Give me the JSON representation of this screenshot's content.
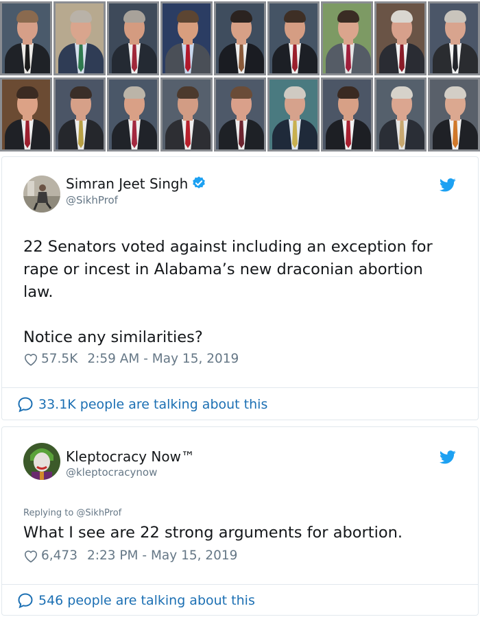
{
  "portrait_grid": {
    "rows": [
      [
        {
          "bg": "#4a5a6b",
          "suit": "#1f2227",
          "shirt": "#eceae6",
          "tie": "#1b1b1b",
          "skin": "#d69f88",
          "hair": "#8a6a4f"
        },
        {
          "bg": "#b7a98f",
          "suit": "#2f3c55",
          "shirt": "#d6e0ec",
          "tie": "#2f7a4f",
          "skin": "#d9a58d",
          "hair": "#b9b2a8"
        },
        {
          "bg": "#3e4a5a",
          "suit": "#242a33",
          "shirt": "#efefef",
          "tie": "#a0283a",
          "skin": "#d49b80",
          "hair": "#a8a29a"
        },
        {
          "bg": "#2b3d63",
          "suit": "#4a4f57",
          "shirt": "#c9d8ee",
          "tie": "#b2182b",
          "skin": "#d89e7e",
          "hair": "#5c4532"
        },
        {
          "bg": "#3f4d5e",
          "suit": "#1a1c22",
          "shirt": "#eeeeee",
          "tie": "#8a5a3a",
          "skin": "#d7a086",
          "hair": "#2b2320"
        },
        {
          "bg": "#455465",
          "suit": "#1c1f25",
          "shirt": "#f0f0f0",
          "tie": "#9a1f2c",
          "skin": "#d59d83",
          "hair": "#3e2f25"
        },
        {
          "bg": "#7d9a64",
          "suit": "#555c66",
          "shirt": "#e6e6e6",
          "tie": "#a01f3c",
          "skin": "#dba58d",
          "hair": "#3a2c24"
        },
        {
          "bg": "#6a5446",
          "suit": "#2a2c33",
          "shirt": "#f2f2f2",
          "tie": "#8a1c28",
          "skin": "#d7a08b",
          "hair": "#d9d6d0"
        },
        {
          "bg": "#4b5668",
          "suit": "#2a2c30",
          "shirt": "#f2f2f2",
          "tie": "#22242a",
          "skin": "#d8a48e",
          "hair": "#c9c4bc"
        }
      ],
      [
        {
          "bg": "#6b4b33",
          "suit": "#1f2126",
          "shirt": "#ededed",
          "tie": "#9c1f2e",
          "skin": "#dca286",
          "hair": "#3b2b22"
        },
        {
          "bg": "#4b5566",
          "suit": "#25272c",
          "shirt": "#ececec",
          "tie": "#b8a045",
          "skin": "#d6a088",
          "hair": "#3a2e28"
        },
        {
          "bg": "#4a5768",
          "suit": "#202329",
          "shirt": "#eeeeee",
          "tie": "#a3283f",
          "skin": "#d9a086",
          "hair": "#bbb4a8"
        },
        {
          "bg": "#56606d",
          "suit": "#2d2e33",
          "shirt": "#eeeeee",
          "tie": "#b8202c",
          "skin": "#d29c84",
          "hair": "#4c3a2d"
        },
        {
          "bg": "#4e5969",
          "suit": "#1e2126",
          "shirt": "#ededed",
          "tie": "#6d2530",
          "skin": "#d9a08a",
          "hair": "#6a4c38"
        },
        {
          "bg": "#4a7a80",
          "suit": "#1f2a3a",
          "shirt": "#dfe6ee",
          "tie": "#c8b050",
          "skin": "#d6a28c",
          "hair": "#cfcac2"
        },
        {
          "bg": "#4c5666",
          "suit": "#1d1f24",
          "shirt": "#f0f0f0",
          "tie": "#a82030",
          "skin": "#d7a086",
          "hair": "#3a2a22"
        },
        {
          "bg": "#55606c",
          "suit": "#2a2e36",
          "shirt": "#e6e6e6",
          "tie": "#c8a870",
          "skin": "#dba690",
          "hair": "#d6d2ca"
        },
        {
          "bg": "#59606a",
          "suit": "#1f2126",
          "shirt": "#f0f0f0",
          "tie": "#d0782a",
          "skin": "#dba890",
          "hair": "#d3cec6"
        }
      ]
    ]
  },
  "tweets": [
    {
      "name": "Simran Jeet Singh",
      "handle": "@SikhProf",
      "verified": true,
      "reply_to": "",
      "text": "22 Senators voted against including an exception for rape or incest in Alabama’s new draconian abortion law.\n\nNotice any similarities?",
      "likes": "57.5K",
      "timestamp": "2:59 AM - May 15, 2019",
      "talking": "33.1K people are talking about this"
    },
    {
      "name": "Kleptocracy Now™",
      "handle": "@kleptocracynow",
      "verified": false,
      "reply_to": "Replying to @SikhProf",
      "text": "What I see are 22 strong arguments for abortion.",
      "likes": "6,473",
      "timestamp": "2:23 PM - May 15, 2019",
      "talking": "546 people are talking about this"
    }
  ],
  "colors": {
    "twitter_blue": "#1da1f2",
    "link_blue": "#1b6fb3",
    "secondary_text": "#657786",
    "border": "#e1e8ed"
  },
  "icons": {
    "like": "heart-outline-icon",
    "talk": "speech-bubble-icon",
    "brand": "twitter-bird-icon",
    "verified": "verified-badge-icon"
  }
}
